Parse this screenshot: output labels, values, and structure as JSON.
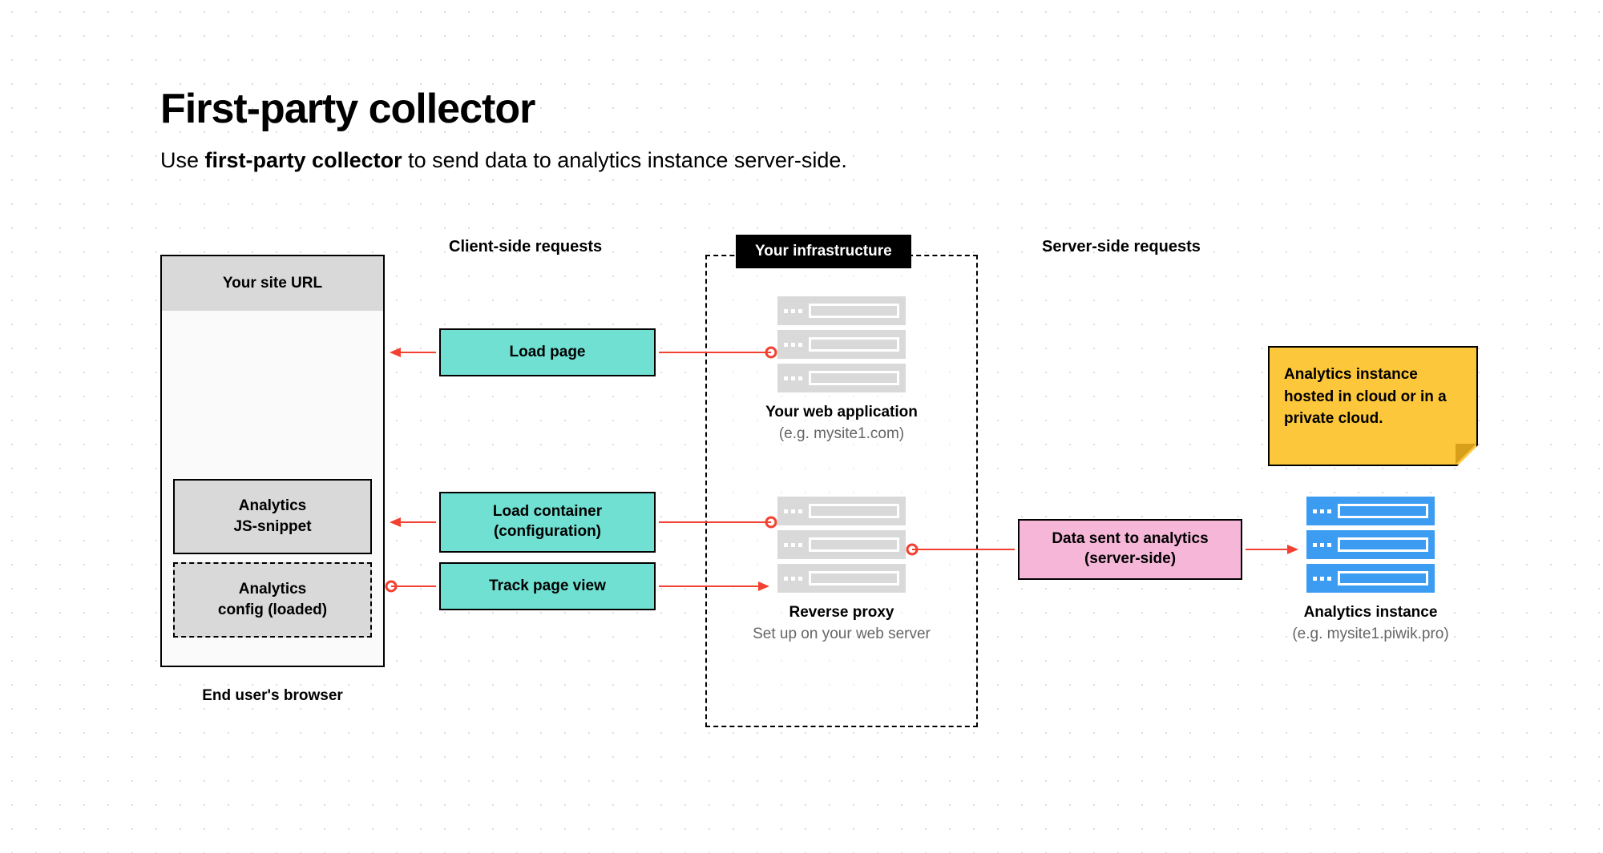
{
  "title": "First-party collector",
  "subtitle_prefix": "Use ",
  "subtitle_bold": "first-party collector",
  "subtitle_suffix": " to send data to analytics instance server-side.",
  "browser": {
    "url_label": "Your site URL",
    "snippet_label": "Analytics\nJS-snippet",
    "config_label": "Analytics\nconfig (loaded)",
    "caption": "End user's browser"
  },
  "sections": {
    "client_side": "Client-side requests",
    "server_side": "Server-side requests",
    "infra_tag": "Your infrastructure"
  },
  "flows": {
    "load_page": "Load page",
    "load_container": "Load container\n(configuration)",
    "track_page_view": "Track page view",
    "data_sent": "Data sent to analytics\n(server-side)"
  },
  "stacks": {
    "webapp_title": "Your web application",
    "webapp_sub": "(e.g. mysite1.com)",
    "proxy_title": "Reverse proxy",
    "proxy_sub": "Set up on your web server",
    "analytics_title": "Analytics instance",
    "analytics_sub": "(e.g. mysite1.piwik.pro)"
  },
  "note": "Analytics instance hosted in cloud or in a private cloud."
}
